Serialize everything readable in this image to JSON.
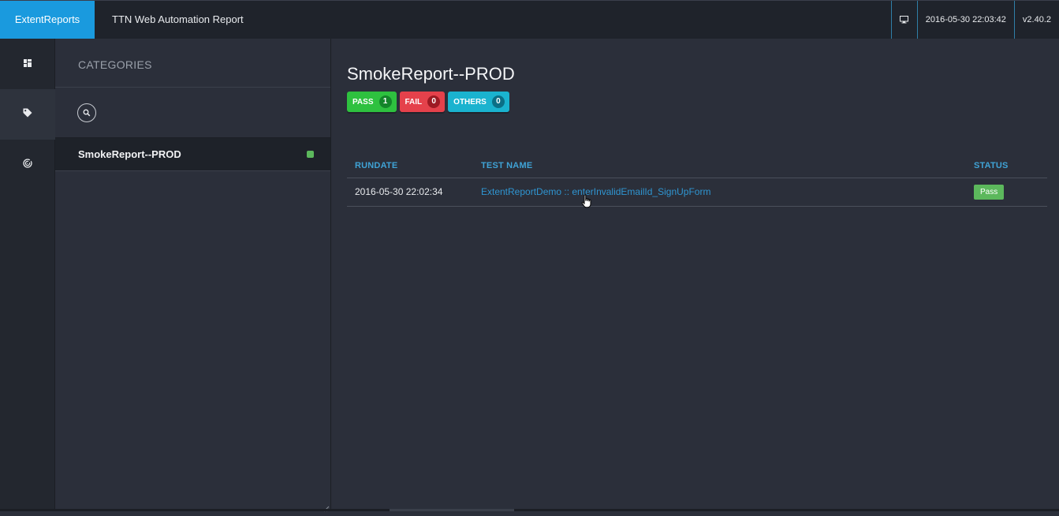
{
  "header": {
    "brand": "ExtentReports",
    "title": "TTN Web Automation Report",
    "datetime": "2016-05-30 22:03:42",
    "version": "v2.40.2",
    "monitor_icon": "monitor-icon"
  },
  "nav": {
    "items": [
      {
        "icon": "dashboard-icon",
        "active": false
      },
      {
        "icon": "tag-icon",
        "active": true
      },
      {
        "icon": "radar-icon",
        "active": false
      }
    ]
  },
  "categories": {
    "heading": "CATEGORIES",
    "search_icon": "search-icon",
    "items": [
      {
        "label": "SmokeReport--PROD",
        "status_color": "#5cb85c"
      }
    ]
  },
  "main": {
    "title": "SmokeReport--PROD",
    "badges": {
      "pass": {
        "label": "PASS",
        "count": "1"
      },
      "fail": {
        "label": "FAIL",
        "count": "0"
      },
      "others": {
        "label": "OTHERS",
        "count": "0"
      }
    },
    "table": {
      "headers": {
        "rundate": "RUNDATE",
        "test_name": "TEST NAME",
        "status": "STATUS"
      },
      "rows": [
        {
          "rundate": "2016-05-30 22:02:34",
          "test_name": "ExtentReportDemo :: enterInvalidEmailId_SignUpForm",
          "status": "Pass"
        }
      ]
    }
  },
  "colors": {
    "brand": "#1a9ade",
    "pass": "#2ec13f",
    "fail": "#e5414b",
    "others": "#1ab3cf",
    "link": "#2f95d1"
  }
}
